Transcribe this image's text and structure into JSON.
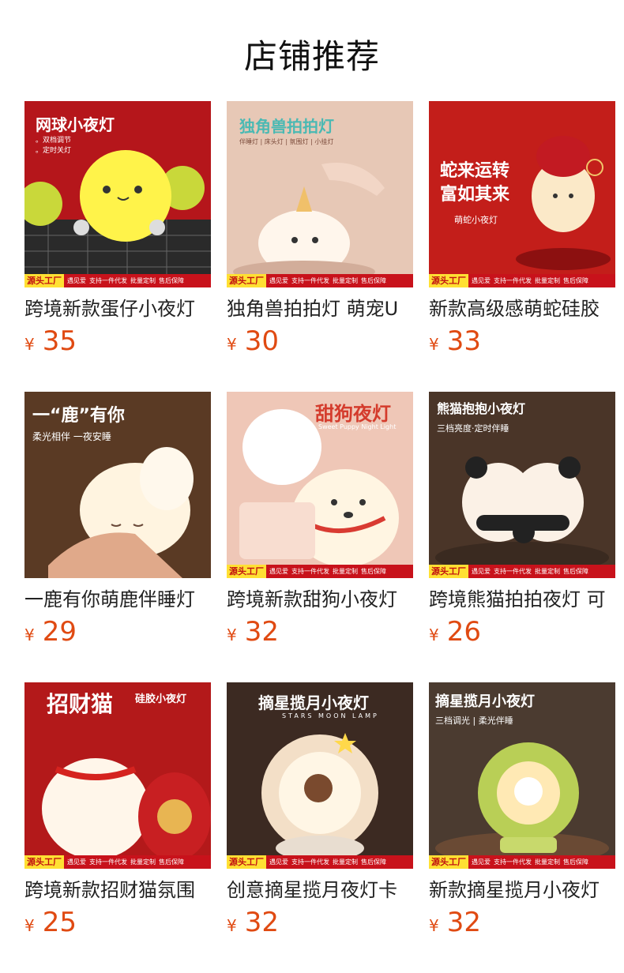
{
  "page": {
    "title": "店铺推荐"
  },
  "tag_strip": {
    "source": "源头工厂",
    "features": [
      "遇见爱",
      "支持一件代发",
      "批量定制",
      "售后保障"
    ]
  },
  "products": [
    {
      "name": "跨境新款蛋仔小夜灯",
      "price": "35",
      "banner_title": "网球小夜灯",
      "banner_sub": "。双档调节\n。定时关灯",
      "bg": "#b5161b"
    },
    {
      "name": "独角兽拍拍灯 萌宠U",
      "price": "30",
      "banner_title": "独角兽拍拍灯",
      "banner_sub": "伴睡灯 | 床头灯 | 氛围灯 | 小挂灯",
      "bg": "#e9cfc0"
    },
    {
      "name": "新款高级感萌蛇硅胶",
      "price": "33",
      "banner_title": "蛇来运转\n富如其来",
      "banner_sub": "萌蛇小夜灯",
      "bg": "#c31e1a"
    },
    {
      "name": "一鹿有你萌鹿伴睡灯",
      "price": "29",
      "banner_title": "一“鹿”有你",
      "banner_sub": "柔光相伴 一夜安睡",
      "bg": "#5a3a24"
    },
    {
      "name": "跨境新款甜狗小夜灯",
      "price": "32",
      "banner_title": "甜狗夜灯",
      "banner_sub": "Sweet Puppy Night Light",
      "bg": "#efc7b7"
    },
    {
      "name": "跨境熊猫拍拍夜灯 可",
      "price": "26",
      "banner_title": "熊猫抱抱小夜灯",
      "banner_sub": "三档亮度·定时伴睡",
      "bg": "#4a3528"
    },
    {
      "name": "跨境新款招财猫氛围",
      "price": "25",
      "banner_title": "招财猫",
      "banner_sub": "硅胶小夜灯",
      "bg": "#b3191a"
    },
    {
      "name": "创意摘星揽月夜灯卡",
      "price": "32",
      "banner_title": "摘星揽月小夜灯",
      "banner_sub": "STARS MOON LAMP",
      "bg": "#3c2a22"
    },
    {
      "name": "新款摘星揽月小夜灯",
      "price": "32",
      "banner_title": "摘星揽月小夜灯",
      "banner_sub": "三档调光 | 柔光伴睡",
      "bg": "#4b3b30"
    }
  ],
  "currency_symbol": "¥",
  "colors": {
    "price": "#e04a12",
    "tag_red": "#c8121b",
    "tag_yellow": "#ffe033"
  }
}
